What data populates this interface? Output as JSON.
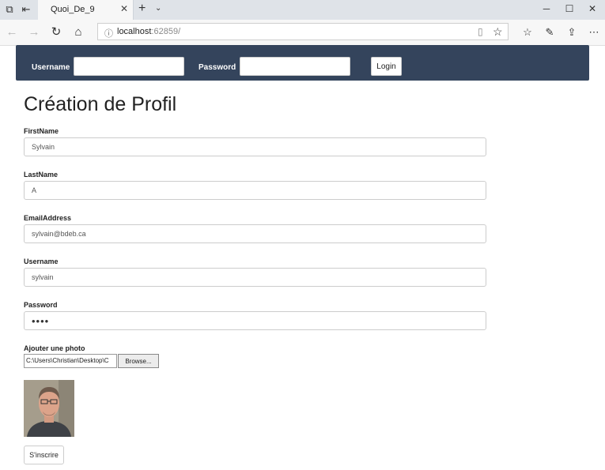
{
  "browser": {
    "tab_title": "Quoi_De_9",
    "url_host": "localhost",
    "url_port": ":62859/"
  },
  "navbar": {
    "username_label": "Username",
    "password_label": "Password",
    "login_label": "Login"
  },
  "page": {
    "title": "Création de Profil"
  },
  "form": {
    "firstname": {
      "label": "FirstName",
      "value": "Sylvain"
    },
    "lastname": {
      "label": "LastName",
      "value": "A"
    },
    "email": {
      "label": "EmailAddress",
      "value": "sylvain@bdeb.ca"
    },
    "username": {
      "label": "Username",
      "value": "sylvain"
    },
    "password": {
      "label": "Password",
      "value": "••••"
    },
    "photo": {
      "label": "Ajouter une photo",
      "file_path": "C:\\Users\\Christian\\Desktop\\C",
      "browse_label": "Browse..."
    },
    "submit_label": "S'inscrire"
  },
  "colors": {
    "navbar_bg": "#34445c",
    "tabbar_bg": "#dfe3e8"
  }
}
